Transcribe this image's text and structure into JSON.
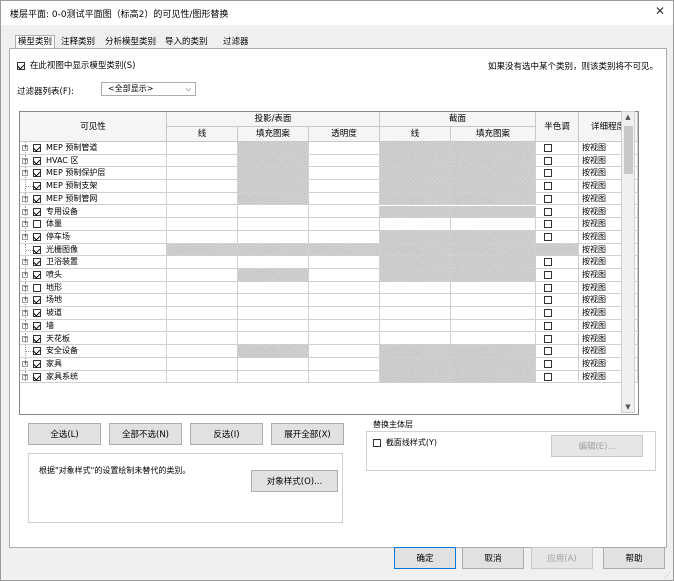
{
  "window": {
    "title": "楼层平面: 0-0测试平面图（标高2）的可见性/图形替换"
  },
  "tabs": [
    "模型类别",
    "注释类别",
    "分析模型类别",
    "导入的类别",
    "过滤器"
  ],
  "active_tab": 0,
  "show_categories_label": "在此视图中显示模型类别(S)",
  "show_categories_checked": true,
  "hint_text": "如果没有选中某个类别，则该类别将不可见。",
  "filter_list": {
    "label": "过滤器列表(F):",
    "value": "<全部显示>"
  },
  "table": {
    "col_visibility": "可见性",
    "group_projection": "投影/表面",
    "group_cut": "截面",
    "col_line": "线",
    "col_fill": "填充图案",
    "col_transparency": "透明度",
    "col_cut_line": "线",
    "col_cut_fill": "填充图案",
    "col_halftone": "半色调",
    "col_detail": "详细程度",
    "rows": [
      {
        "name": "MEP 预制管道",
        "checked": true,
        "expandable": true,
        "pgrey": [
          false,
          true,
          false
        ],
        "cgrey": [
          true,
          true
        ],
        "half": true,
        "detail": "按视图"
      },
      {
        "name": "HVAC 区",
        "checked": true,
        "expandable": true,
        "pgrey": [
          false,
          true,
          false
        ],
        "cgrey": [
          true,
          true
        ],
        "half": true,
        "detail": "按视图"
      },
      {
        "name": "MEP 预制保护层",
        "checked": true,
        "expandable": true,
        "pgrey": [
          false,
          true,
          false
        ],
        "cgrey": [
          true,
          true
        ],
        "half": true,
        "detail": "按视图"
      },
      {
        "name": "MEP 预制支架",
        "checked": true,
        "expandable": false,
        "pgrey": [
          false,
          true,
          false
        ],
        "cgrey": [
          true,
          true
        ],
        "half": true,
        "detail": "按视图"
      },
      {
        "name": "MEP 预制管网",
        "checked": true,
        "expandable": true,
        "pgrey": [
          false,
          true,
          false
        ],
        "cgrey": [
          true,
          true
        ],
        "half": true,
        "detail": "按视图"
      },
      {
        "name": "专用设备",
        "checked": true,
        "expandable": true,
        "pgrey": [
          false,
          false,
          false
        ],
        "cgrey": [
          true,
          true
        ],
        "half": true,
        "detail": "按视图"
      },
      {
        "name": "体量",
        "checked": false,
        "expandable": true,
        "pgrey": [
          false,
          false,
          false
        ],
        "cgrey": [
          false,
          false
        ],
        "half": true,
        "detail": "按视图"
      },
      {
        "name": "停车场",
        "checked": true,
        "expandable": true,
        "pgrey": [
          false,
          false,
          false
        ],
        "cgrey": [
          true,
          true
        ],
        "half": true,
        "detail": "按视图"
      },
      {
        "name": "光栅图像",
        "checked": true,
        "expandable": false,
        "pgrey": [
          true,
          true,
          true
        ],
        "cgrey": [
          true,
          true
        ],
        "half": false,
        "hgrey": true,
        "detail": "按视图"
      },
      {
        "name": "卫浴装置",
        "checked": true,
        "expandable": true,
        "pgrey": [
          false,
          false,
          false
        ],
        "cgrey": [
          true,
          true
        ],
        "half": true,
        "detail": "按视图"
      },
      {
        "name": "喷头",
        "checked": true,
        "expandable": true,
        "pgrey": [
          false,
          true,
          false
        ],
        "cgrey": [
          true,
          true
        ],
        "half": true,
        "detail": "按视图"
      },
      {
        "name": "地形",
        "checked": false,
        "expandable": true,
        "pgrey": [
          false,
          false,
          false
        ],
        "cgrey": [
          false,
          false
        ],
        "half": true,
        "detail": "按视图"
      },
      {
        "name": "场地",
        "checked": true,
        "expandable": true,
        "pgrey": [
          false,
          false,
          false
        ],
        "cgrey": [
          false,
          false
        ],
        "half": true,
        "detail": "按视图"
      },
      {
        "name": "坡道",
        "checked": true,
        "expandable": true,
        "pgrey": [
          false,
          false,
          false
        ],
        "cgrey": [
          false,
          false
        ],
        "half": true,
        "detail": "按视图"
      },
      {
        "name": "墙",
        "checked": true,
        "expandable": true,
        "pgrey": [
          false,
          false,
          false
        ],
        "cgrey": [
          false,
          false
        ],
        "half": true,
        "detail": "按视图"
      },
      {
        "name": "天花板",
        "checked": true,
        "expandable": true,
        "pgrey": [
          false,
          false,
          false
        ],
        "cgrey": [
          false,
          false
        ],
        "half": true,
        "detail": "按视图"
      },
      {
        "name": "安全设备",
        "checked": true,
        "expandable": false,
        "pgrey": [
          false,
          true,
          false
        ],
        "cgrey": [
          true,
          true
        ],
        "half": true,
        "detail": "按视图"
      },
      {
        "name": "家具",
        "checked": true,
        "expandable": true,
        "pgrey": [
          false,
          false,
          false
        ],
        "cgrey": [
          true,
          true
        ],
        "half": true,
        "detail": "按视图"
      },
      {
        "name": "家具系统",
        "checked": true,
        "expandable": true,
        "pgrey": [
          false,
          false,
          false
        ],
        "cgrey": [
          true,
          true
        ],
        "half": true,
        "detail": "按视图"
      }
    ]
  },
  "buttons": {
    "select_all": "全选(L)",
    "select_none": "全部不选(N)",
    "invert": "反选(I)",
    "expand_all": "展开全部(X)",
    "object_styles": "对象样式(O)...",
    "edit": "编辑(E)...",
    "ok": "确定",
    "cancel": "取消",
    "apply": "应用(A)",
    "help": "帮助"
  },
  "object_styles_note": "根据\"对象样式\"的设置绘制未替代的类别。",
  "host_layers": {
    "title": "替换主体层",
    "cut_line_styles": "截面线样式(Y)",
    "cut_line_checked": false
  }
}
